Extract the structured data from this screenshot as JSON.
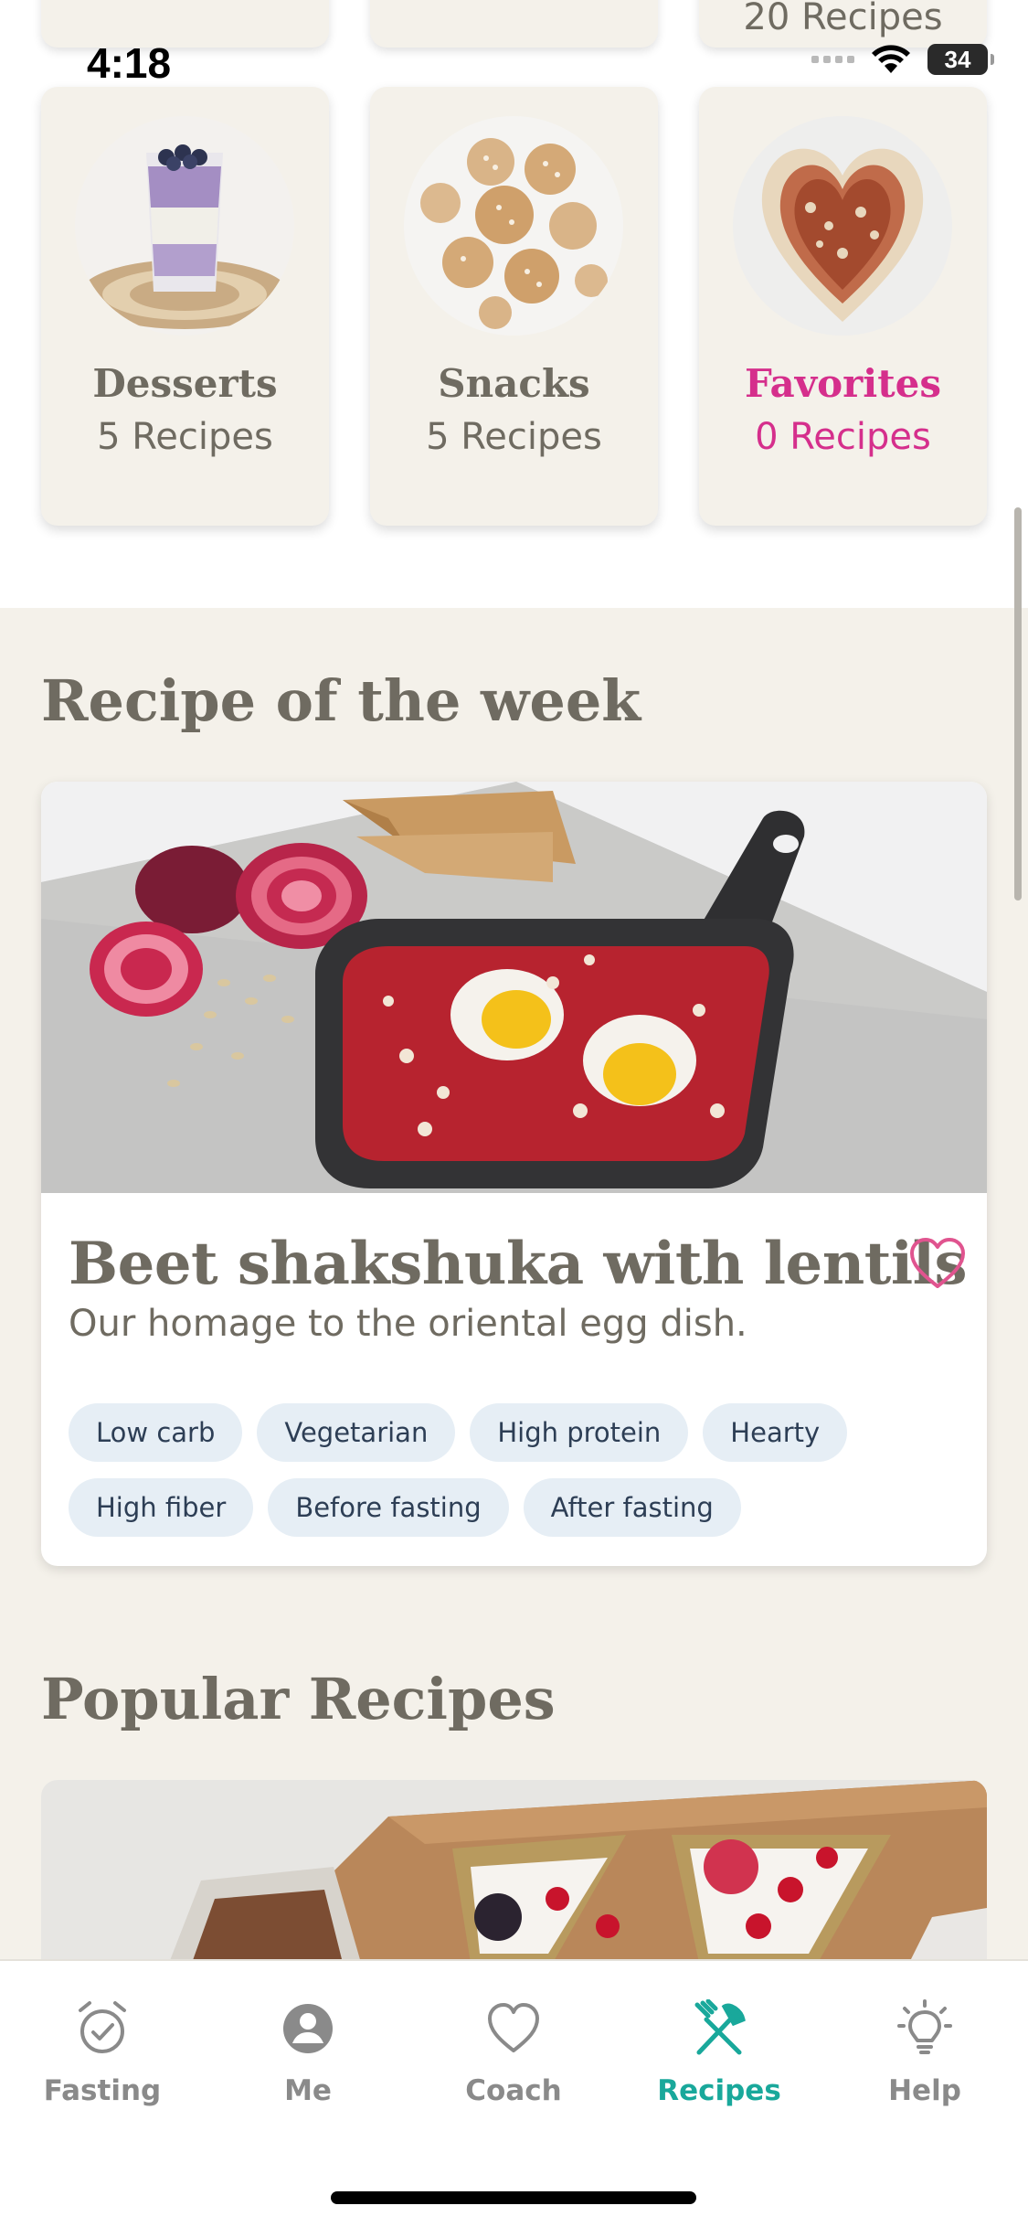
{
  "status_bar": {
    "time": "4:18",
    "battery": "34"
  },
  "partial_cards": [
    {
      "count_text": ""
    },
    {
      "count_text": ""
    },
    {
      "count_text": "20 Recipes"
    }
  ],
  "categories": [
    {
      "title": "Desserts",
      "count": "5 Recipes",
      "image": "chia-pudding-glass"
    },
    {
      "title": "Snacks",
      "count": "5 Recipes",
      "image": "energy-balls"
    },
    {
      "title": "Favorites",
      "count": "0 Recipes",
      "image": "heart-pancake",
      "accent": "#d52f8c"
    }
  ],
  "recipe_of_week": {
    "section_title": "Recipe of the week",
    "title": "Beet shakshuka with lentils",
    "subtitle": "Our homage to the oriental egg dish.",
    "tags": [
      "Low carb",
      "Vegetarian",
      "High protein",
      "Hearty",
      "High fiber",
      "Before fasting",
      "After fasting"
    ]
  },
  "popular": {
    "section_title": "Popular Recipes"
  },
  "tab_bar": {
    "tabs": [
      {
        "label": "Fasting",
        "icon": "alarm-clock-check-icon"
      },
      {
        "label": "Me",
        "icon": "user-circle-icon"
      },
      {
        "label": "Coach",
        "icon": "heart-outline-icon"
      },
      {
        "label": "Recipes",
        "icon": "fork-knife-icon",
        "active": true
      },
      {
        "label": "Help",
        "icon": "lightbulb-icon"
      }
    ]
  },
  "colors": {
    "accent_teal": "#19a89b",
    "accent_pink": "#d52f8c",
    "text_warm_gray": "#6f6b61",
    "section_bg": "#f4f1ea",
    "tag_bg": "#e6eef5"
  }
}
